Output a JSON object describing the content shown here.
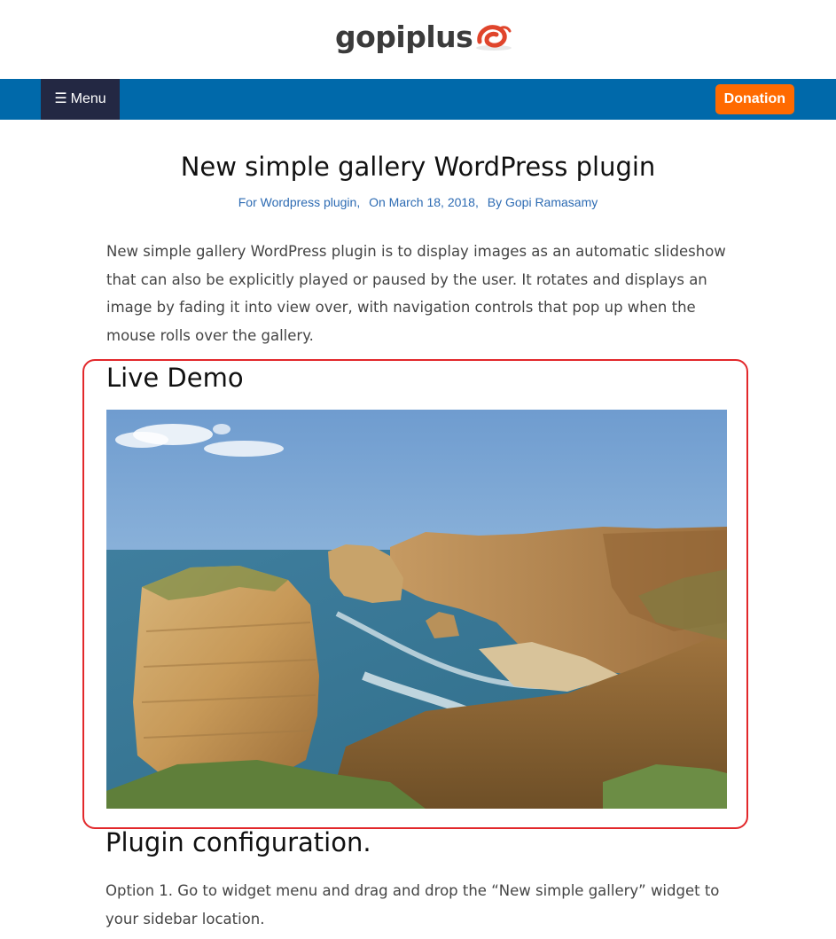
{
  "header": {
    "logo_text": "gopiplus",
    "logo_icon": "swirl-logo-icon",
    "brand_color": "#e0452c"
  },
  "nav": {
    "menu_label": "Menu",
    "menu_icon": "hamburger-icon",
    "donation_label": "Donation",
    "bar_color": "#0069aa",
    "menu_bg": "#232843",
    "donation_color": "#ff6a00"
  },
  "post": {
    "title": "New simple gallery WordPress plugin",
    "meta": {
      "category": "For Wordpress plugin,",
      "date": "On March 18, 2018,",
      "author": "By Gopi Ramasamy"
    },
    "intro": "New simple gallery WordPress plugin is to display images as an automatic slideshow that can also be explicitly played or paused by the user. It rotates and displays an image by fading it into view over, with navigation controls that pop up when the mouse rolls over the gallery."
  },
  "demo": {
    "heading": "Live Demo",
    "highlight_color": "#e2282b"
  },
  "configuration": {
    "heading": "Plugin configuration.",
    "option1": "Option 1. Go to widget menu and drag and drop the “New simple gallery” widget to your sidebar location."
  }
}
